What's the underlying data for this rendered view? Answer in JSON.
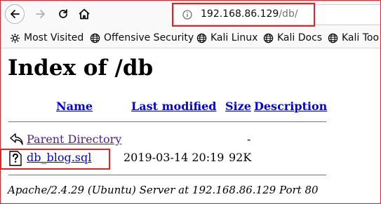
{
  "browser": {
    "url_host": "192.168.86.129",
    "url_path": "/db/",
    "bookmarks": [
      {
        "label": "Most Visited",
        "icon": "gear-icon"
      },
      {
        "label": "Offensive Security",
        "icon": "globe-icon"
      },
      {
        "label": "Kali Linux",
        "icon": "globe-icon"
      },
      {
        "label": "Kali Docs",
        "icon": "globe-icon"
      },
      {
        "label": "Kali Too",
        "icon": "globe-icon"
      }
    ],
    "highlight_color": "#e8202a"
  },
  "page": {
    "title": "Index of /db",
    "columns": {
      "name": "Name",
      "last_modified": "Last modified",
      "size": "Size",
      "description": "Description"
    },
    "rows": [
      {
        "name": "Parent Directory",
        "last_modified": "",
        "size": "-",
        "icon": "back-arrow-icon"
      },
      {
        "name": "db_blog.sql",
        "last_modified": "2019-03-14 20:19",
        "size": "92K",
        "icon": "unknown-file-icon"
      }
    ],
    "address": "Apache/2.4.29 (Ubuntu) Server at 192.168.86.129 Port 80"
  }
}
